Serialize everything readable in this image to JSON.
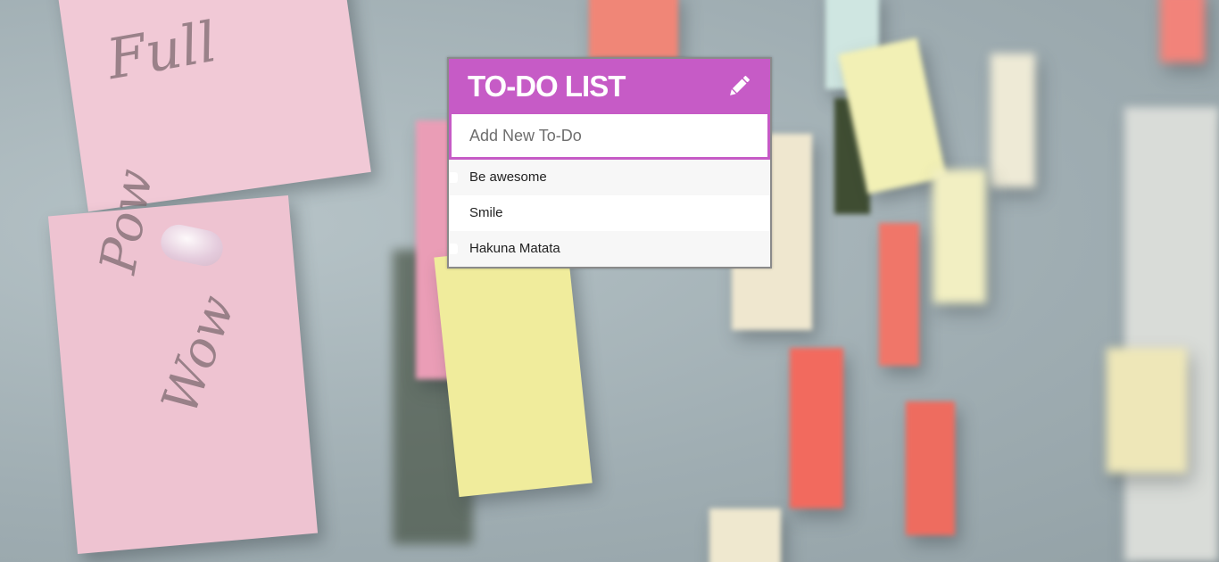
{
  "todo": {
    "title": "TO-DO LIST",
    "header_icon": "pencil-icon",
    "input_placeholder": "Add New To-Do",
    "input_value": "",
    "accent_color": "#c65bc6",
    "items": [
      {
        "text": "Be awesome"
      },
      {
        "text": "Smile"
      },
      {
        "text": "Hakuna Matata"
      }
    ]
  },
  "background": {
    "description_icon": "corkboard-sticky-notes",
    "note_texts": [
      "Full",
      "Pow",
      "Wow"
    ]
  }
}
